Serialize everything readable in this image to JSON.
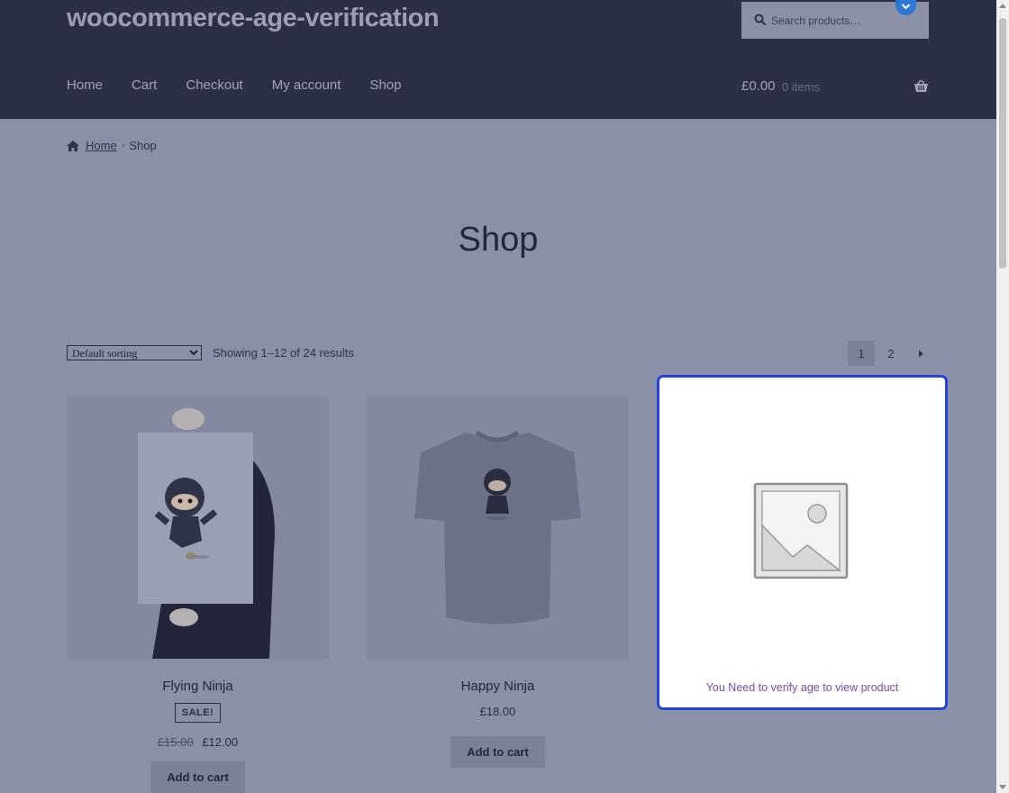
{
  "site": {
    "title": "woocommerce-age-verification"
  },
  "search": {
    "placeholder": "Search products…"
  },
  "nav": {
    "items": [
      "Home",
      "Cart",
      "Checkout",
      "My account",
      "Shop"
    ]
  },
  "cart": {
    "total": "£0.00",
    "count": "0 items"
  },
  "breadcrumb": {
    "home": "Home",
    "current": "Shop"
  },
  "page": {
    "title": "Shop"
  },
  "toolbar": {
    "sort_selected": "Default sorting",
    "result_count": "Showing 1–12 of 24 results",
    "pages": [
      "1",
      "2"
    ]
  },
  "products": [
    {
      "name": "Flying Ninja",
      "badge": "SALE!",
      "old_price": "£15.00",
      "price": "£12.00",
      "button": "Add to cart"
    },
    {
      "name": "Happy Ninja",
      "price": "£18.00",
      "button": "Add to cart"
    }
  ],
  "verify_card": {
    "message": "You Need to verify age to view product"
  },
  "colors": {
    "header": "#2c3045",
    "overlay": "#8a90a6",
    "accent_border": "#2244dd",
    "message": "#7b4bb0"
  }
}
